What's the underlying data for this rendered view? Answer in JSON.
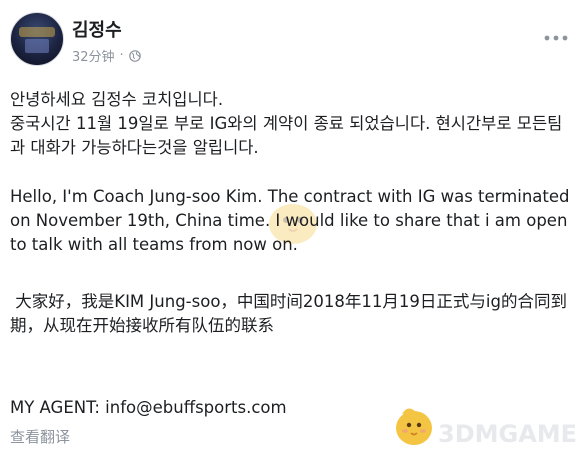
{
  "post": {
    "author": "김정수",
    "time": "32分钟",
    "separator": "·",
    "paragraphs": {
      "korean": "안녕하세요 김정수 코치입니다.\n중국시간 11월 19일로 부로 IG와의 계약이 종료 되었습니다. 현시간부로 모든팀과 대화가 가능하다는것을 알립니다.",
      "english": "Hello, I'm Coach Jung-soo Kim. The contract with IG was terminated on November 19th, China time. I would like to share that i am open to talk with all teams from now on.",
      "chinese": " 大家好，我是KIM Jung-soo，中国时间2018年11月19日正式与ig的合同到期，从现在开始接收所有队伍的联系",
      "agent": "MY AGENT: info@ebuffsports.com"
    },
    "translate_label": "查看翻译"
  },
  "watermark": {
    "text": "3DMGAME"
  },
  "colors": {
    "text": "#1c1e21",
    "meta": "#8d949e",
    "background": "#ffffff"
  },
  "icons": {
    "privacy": "globe-icon",
    "menu": "more-options-icon"
  }
}
